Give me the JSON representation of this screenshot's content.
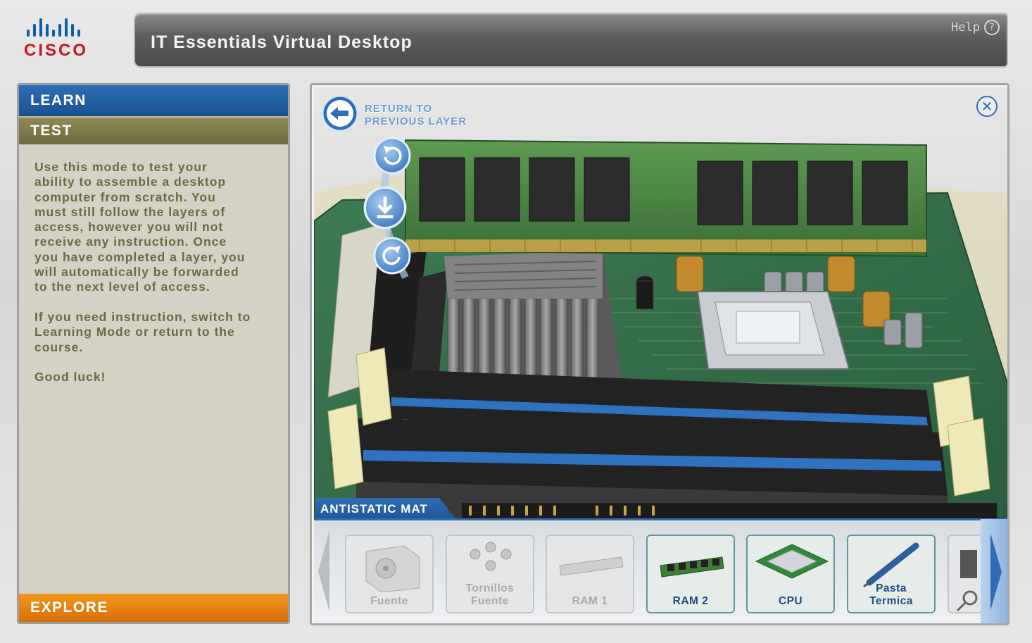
{
  "header": {
    "logo_text": "CISCO",
    "title": "IT Essentials Virtual Desktop",
    "help_label": "Help",
    "help_icon": "question-circle-icon"
  },
  "left_panel": {
    "tabs": {
      "learn": "LEARN",
      "test": "TEST",
      "explore": "EXPLORE"
    },
    "description": "Use this mode to test your\nability to assemble a desktop\ncomputer from scratch. You\nmust still follow the layers of\naccess, however you will not\nreceive any instruction. Once\nyou have completed a layer, you\nwill automatically be forwarded\nto the next level of access.\n\nIf you need instruction, switch to\nLearning Mode or return to the\ncourse.\n\nGood luck!"
  },
  "viewer": {
    "return_label": "RETURN TO\nPREVIOUS LAYER",
    "close_icon": "close-circle-icon",
    "controls": [
      "rotate-left-icon",
      "download-icon",
      "rotate-right-icon"
    ],
    "surface_label": "ANTISTATIC MAT"
  },
  "tray": {
    "parts": [
      {
        "name": "Fuente",
        "active": false,
        "icon": "power-supply-icon"
      },
      {
        "name": "Tornillos\nFuente",
        "active": false,
        "icon": "screws-icon"
      },
      {
        "name": "RAM 1",
        "active": false,
        "icon": "ram-icon"
      },
      {
        "name": "RAM 2",
        "active": true,
        "icon": "ram-icon"
      },
      {
        "name": "CPU",
        "active": true,
        "icon": "cpu-icon"
      },
      {
        "name": "Pasta\nTermica",
        "active": true,
        "icon": "thermal-paste-icon"
      }
    ]
  },
  "colors": {
    "accent_blue": "#2e6eb5",
    "learn_tab": "#1a4f8e",
    "test_tab": "#7d7a4a",
    "explore_tab": "#e57e10",
    "logo_red": "#c7161f"
  }
}
